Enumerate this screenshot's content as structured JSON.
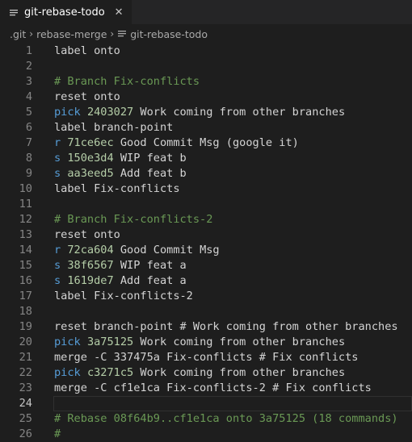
{
  "tab": {
    "title": "git-rebase-todo",
    "close": "✕"
  },
  "breadcrumb": [
    ".git",
    "rebase-merge",
    "git-rebase-todo"
  ],
  "lines": [
    {
      "n": "1",
      "parts": [
        {
          "t": "label onto",
          "c": ""
        }
      ]
    },
    {
      "n": "2",
      "parts": []
    },
    {
      "n": "3",
      "parts": [
        {
          "t": "# Branch Fix-conflicts",
          "c": "comment"
        }
      ]
    },
    {
      "n": "4",
      "parts": [
        {
          "t": "reset onto",
          "c": ""
        }
      ]
    },
    {
      "n": "5",
      "parts": [
        {
          "t": "pick",
          "c": "kw"
        },
        {
          "t": " ",
          "c": ""
        },
        {
          "t": "2403027",
          "c": "hash"
        },
        {
          "t": " Work coming from other branches",
          "c": ""
        }
      ]
    },
    {
      "n": "6",
      "parts": [
        {
          "t": "label branch-point",
          "c": ""
        }
      ]
    },
    {
      "n": "7",
      "parts": [
        {
          "t": "r",
          "c": "kw"
        },
        {
          "t": " ",
          "c": ""
        },
        {
          "t": "71ce6ec",
          "c": "hash"
        },
        {
          "t": " Good Commit Msg (google it)",
          "c": ""
        }
      ]
    },
    {
      "n": "8",
      "parts": [
        {
          "t": "s",
          "c": "kw"
        },
        {
          "t": " ",
          "c": ""
        },
        {
          "t": "150e3d4",
          "c": "hash"
        },
        {
          "t": " WIP feat b",
          "c": ""
        }
      ]
    },
    {
      "n": "9",
      "parts": [
        {
          "t": "s",
          "c": "kw"
        },
        {
          "t": " ",
          "c": ""
        },
        {
          "t": "aa3eed5",
          "c": "hash"
        },
        {
          "t": " Add feat b",
          "c": ""
        }
      ]
    },
    {
      "n": "10",
      "parts": [
        {
          "t": "label Fix-conflicts",
          "c": ""
        }
      ]
    },
    {
      "n": "11",
      "parts": []
    },
    {
      "n": "12",
      "parts": [
        {
          "t": "# Branch Fix-conflicts-2",
          "c": "comment"
        }
      ]
    },
    {
      "n": "13",
      "parts": [
        {
          "t": "reset onto",
          "c": ""
        }
      ]
    },
    {
      "n": "14",
      "parts": [
        {
          "t": "r",
          "c": "kw"
        },
        {
          "t": " ",
          "c": ""
        },
        {
          "t": "72ca604",
          "c": "hash"
        },
        {
          "t": " Good Commit Msg",
          "c": ""
        }
      ]
    },
    {
      "n": "15",
      "parts": [
        {
          "t": "s",
          "c": "kw"
        },
        {
          "t": " ",
          "c": ""
        },
        {
          "t": "38f6567",
          "c": "hash"
        },
        {
          "t": " WIP feat a",
          "c": ""
        }
      ]
    },
    {
      "n": "16",
      "parts": [
        {
          "t": "s",
          "c": "kw"
        },
        {
          "t": " ",
          "c": ""
        },
        {
          "t": "1619de7",
          "c": "hash"
        },
        {
          "t": " Add feat a",
          "c": ""
        }
      ]
    },
    {
      "n": "17",
      "parts": [
        {
          "t": "label Fix-conflicts-2",
          "c": ""
        }
      ]
    },
    {
      "n": "18",
      "parts": []
    },
    {
      "n": "19",
      "parts": [
        {
          "t": "reset branch-point # Work coming from other branches",
          "c": ""
        }
      ]
    },
    {
      "n": "20",
      "parts": [
        {
          "t": "pick",
          "c": "kw"
        },
        {
          "t": " ",
          "c": ""
        },
        {
          "t": "3a75125",
          "c": "hash"
        },
        {
          "t": " Work coming from other branches",
          "c": ""
        }
      ]
    },
    {
      "n": "21",
      "parts": [
        {
          "t": "merge -C 337475a Fix-conflicts # Fix conflicts",
          "c": ""
        }
      ]
    },
    {
      "n": "22",
      "parts": [
        {
          "t": "pick",
          "c": "kw"
        },
        {
          "t": " ",
          "c": ""
        },
        {
          "t": "c3271c5",
          "c": "hash"
        },
        {
          "t": " Work coming from other branches",
          "c": ""
        }
      ]
    },
    {
      "n": "23",
      "parts": [
        {
          "t": "merge -C cf1e1ca Fix-conflicts-2 # Fix conflicts",
          "c": ""
        }
      ]
    },
    {
      "n": "24",
      "parts": [],
      "active": true
    },
    {
      "n": "25",
      "parts": [
        {
          "t": "# Rebase 08f64b9..cf1e1ca onto 3a75125 (18 commands)",
          "c": "comment"
        }
      ]
    },
    {
      "n": "26",
      "parts": [
        {
          "t": "#",
          "c": "comment"
        }
      ]
    }
  ]
}
